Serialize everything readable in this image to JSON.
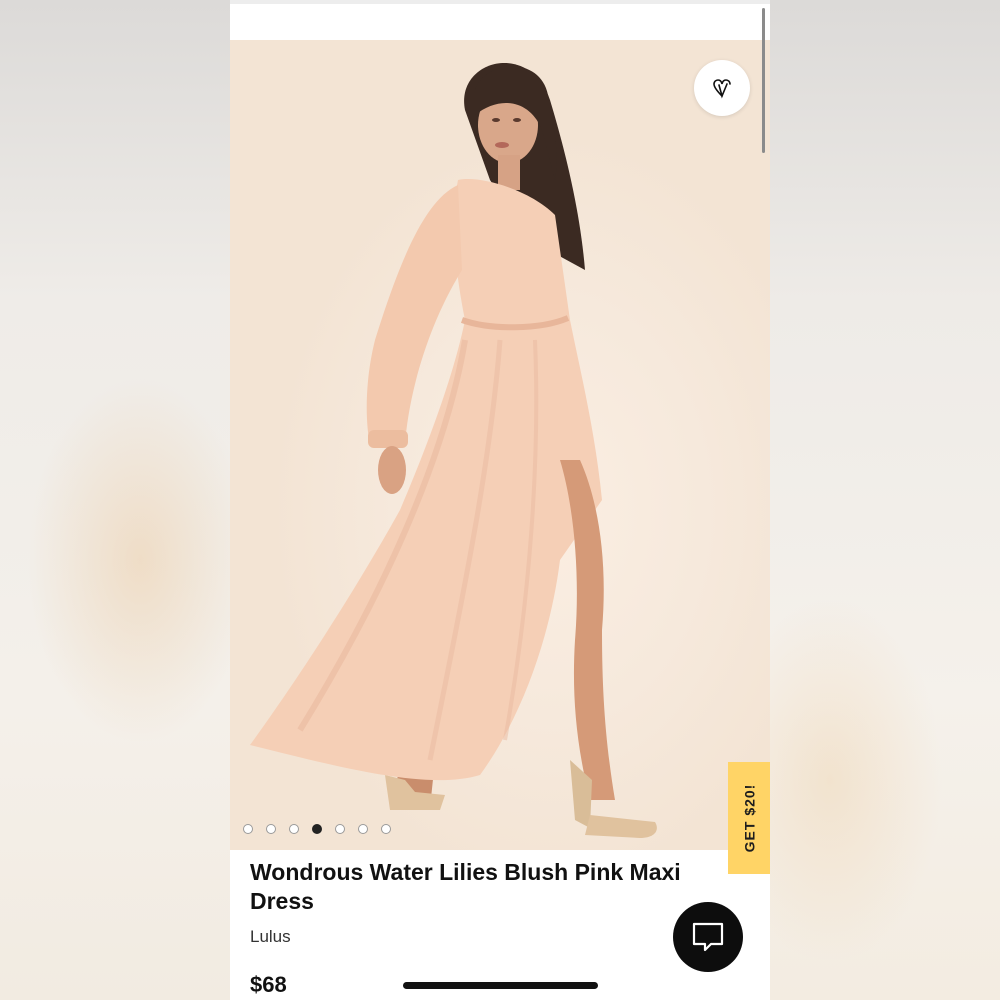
{
  "product": {
    "title": "Wondrous Water Lilies Blush Pink Maxi Dress",
    "brand": "Lulus",
    "price": "$68"
  },
  "gallery": {
    "image_count": 7,
    "active_index": 4,
    "dress_color": "#f5cfb6"
  },
  "promo": {
    "label": "GET $20!",
    "color": "#ffd466"
  },
  "icons": {
    "wishlist": "heart-icon",
    "chat": "chat-bubble-icon"
  }
}
